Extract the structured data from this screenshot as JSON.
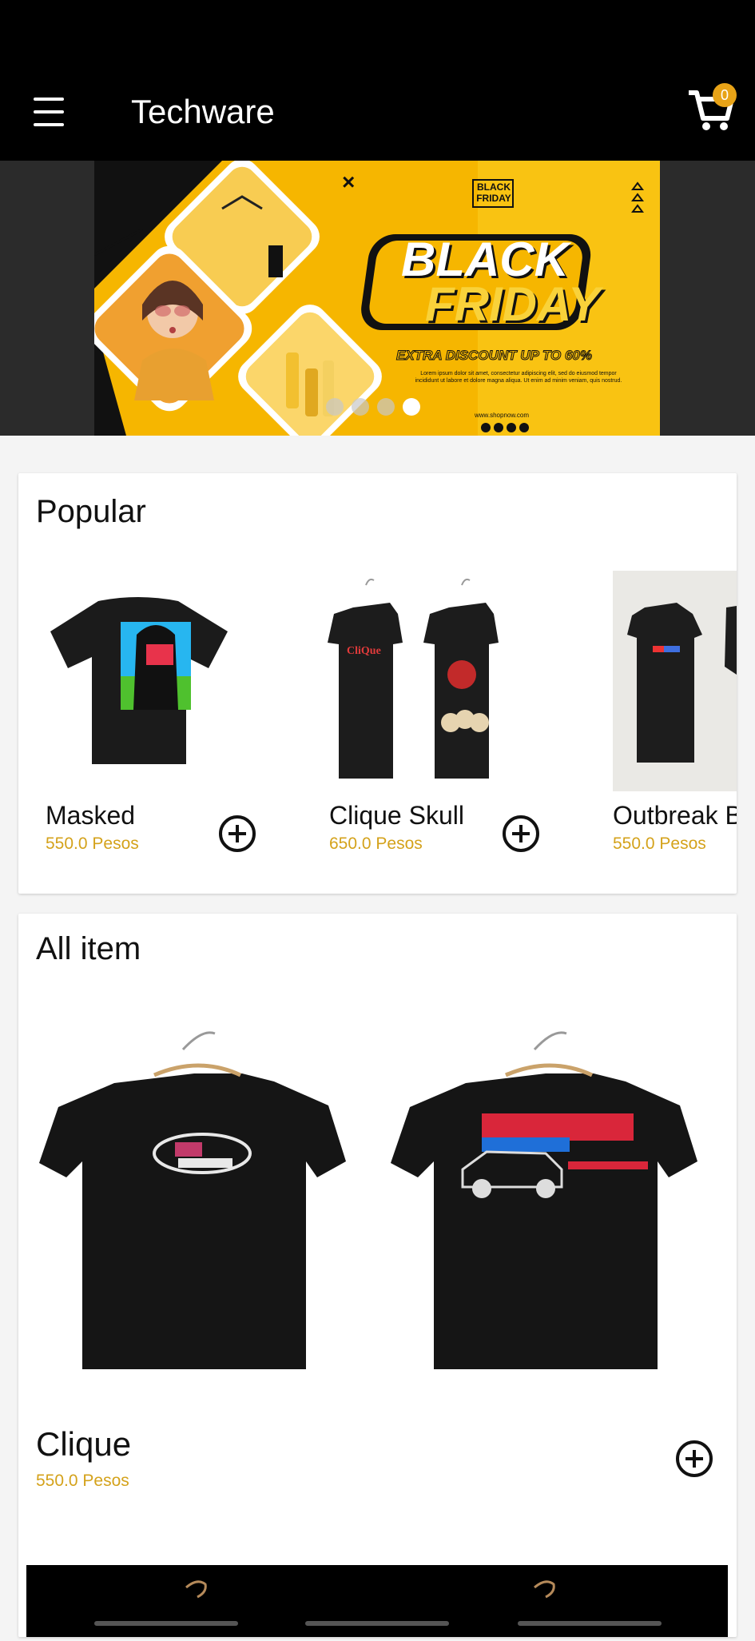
{
  "app_bar": {
    "title": "Techware",
    "cart_count": "0",
    "accent": "#e8a317"
  },
  "banner": {
    "heading_line1": "BLACK",
    "heading_line2": "FRIDAY",
    "tag_line1": "BLACK",
    "tag_line2": "FRIDAY",
    "discount": "EXTRA DISCOUNT UP TO 60%",
    "body": "Lorem ipsum dolor sit amet, consectetur adipiscing elit, sed do eiusmod tempor incididunt ut labore et dolore magna aliqua. Ut enim ad minim veniam, quis nostrud.",
    "website": "www.shopnow.com",
    "dots_count": 4,
    "active_dot": 3
  },
  "popular": {
    "title": "Popular",
    "items": [
      {
        "name": "Masked",
        "price": "550.0 Pesos"
      },
      {
        "name": "Clique Skull",
        "price": "650.0 Pesos"
      },
      {
        "name": "Outbreak Bl",
        "price": "550.0 Pesos"
      }
    ]
  },
  "all_items": {
    "title": "All item",
    "items": [
      {
        "name": "Clique",
        "price": "550.0 Pesos"
      }
    ]
  },
  "colors": {
    "price": "#d4a21b",
    "banner_yellow": "#f6b600",
    "app_bar": "#000000"
  }
}
